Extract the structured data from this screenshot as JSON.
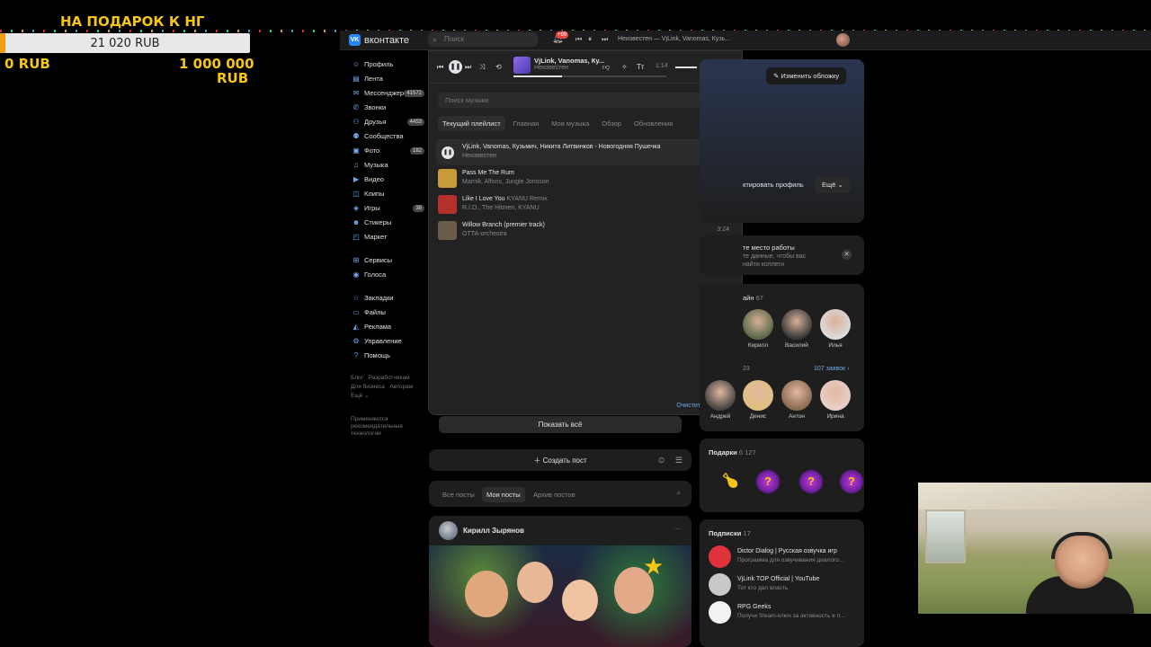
{
  "overlay": {
    "title": "НА ПОДАРОК К НГ",
    "current": "21 020 RUB",
    "min": "0 RUB",
    "max_line1": "1 000 000",
    "max_line2": "RUB",
    "progress_fraction": 0.021
  },
  "topbar": {
    "brand": "вконтакте",
    "search_placeholder": "Поиск",
    "notif_badge": "+99",
    "now_playing": "Неизвестен — VjLink, Vanomas, Кузь..."
  },
  "nav": {
    "items": [
      {
        "label": "Профиль",
        "icon": "user-icon",
        "count": ""
      },
      {
        "label": "Лента",
        "icon": "feed-icon",
        "count": ""
      },
      {
        "label": "Мессенджер",
        "icon": "chat-icon",
        "count": "41572"
      },
      {
        "label": "Звонки",
        "icon": "phone-icon",
        "count": ""
      },
      {
        "label": "Друзья",
        "icon": "friends-icon",
        "count": "4453"
      },
      {
        "label": "Сообщества",
        "icon": "groups-icon",
        "count": ""
      },
      {
        "label": "Фото",
        "icon": "photo-icon",
        "count": "182"
      },
      {
        "label": "Музыка",
        "icon": "music-icon",
        "count": ""
      },
      {
        "label": "Видео",
        "icon": "video-icon",
        "count": ""
      },
      {
        "label": "Клипы",
        "icon": "clips-icon",
        "count": ""
      },
      {
        "label": "Игры",
        "icon": "games-icon",
        "count": "38"
      },
      {
        "label": "Стикеры",
        "icon": "sticker-icon",
        "count": ""
      },
      {
        "label": "Маркет",
        "icon": "market-icon",
        "count": ""
      }
    ],
    "items2": [
      {
        "label": "Сервисы",
        "icon": "services-icon"
      },
      {
        "label": "Голоса",
        "icon": "votes-icon"
      }
    ],
    "items3": [
      {
        "label": "Закладки",
        "icon": "bookmark-icon"
      },
      {
        "label": "Файлы",
        "icon": "file-icon"
      },
      {
        "label": "Реклама",
        "icon": "ads-icon"
      },
      {
        "label": "Управление",
        "icon": "manage-icon"
      },
      {
        "label": "Помощь",
        "icon": "help-icon"
      }
    ],
    "footer": [
      "Блог",
      "Разработчикам",
      "Для бизнеса",
      "Авторам",
      "Ещё ⌄"
    ],
    "recommend": "Применяются рекомендательные технологии"
  },
  "music": {
    "current_title": "VjLink, Vanomas, Ку...",
    "current_artist": "Неизвестен",
    "time": "1:14",
    "progress_fraction": 0.32,
    "search_placeholder": "Поиск музыки",
    "tabs": [
      "Текущий плейлист",
      "Главная",
      "Моя музыка",
      "Обзор",
      "Обновления"
    ],
    "tracks": [
      {
        "title": "VjLink, Vanomas, Кузьмич, Никита Литвинков - Новогодняя Пушечка",
        "remix": "",
        "artist": "Неизвестен",
        "duration": "",
        "color": "#7a5ad8"
      },
      {
        "title": "Pass Me The Rum",
        "remix": "",
        "artist": "Marnik, Alfons, Jungle Jonsson",
        "duration": "2:33",
        "color": "#c79a3a"
      },
      {
        "title": "Like I Love You",
        "remix": "KYANU Remix",
        "artist": "R.I.O., The Hitmen, KYANU",
        "duration": "2:32",
        "color": "#b5302a"
      },
      {
        "title": "Willow Branch (premier track)",
        "remix": "",
        "artist": "OTTA-orchestra",
        "duration": "3:24",
        "color": "#6a5e4a"
      }
    ],
    "clear_label": "Очистить плейлист"
  },
  "feed": {
    "show_all": "Показать всё",
    "create_post": "Создать пост",
    "post_tabs": [
      "Все посты",
      "Мои посты",
      "Архив постов"
    ],
    "author": "Кирилл Зырянов"
  },
  "right": {
    "change_cover": "Изменить обложку",
    "edit_profile": "ктировать профиль",
    "more": "Ещё",
    "work_title": "те место работы",
    "work_desc": "те данные, чтобы вас найти коллеги",
    "friends_header": "айн",
    "friends_count": "67",
    "friends_online": [
      {
        "name": "Кирилл",
        "color": "#5a6a4a"
      },
      {
        "name": "Василий",
        "color": "#3a3a3a"
      },
      {
        "name": "Илья",
        "color": "#dcdcdc"
      }
    ],
    "friends_label2": "23",
    "requests_label": "107 заявок",
    "friends_all": [
      {
        "name": "Андрей",
        "color": "#444"
      },
      {
        "name": "Денис",
        "color": "#e0c080"
      },
      {
        "name": "Антон",
        "color": "#8a6a50"
      },
      {
        "name": "Ирина",
        "color": "#e8d0c8"
      }
    ],
    "gifts_title": "Подарки",
    "gifts_count": "6 127",
    "subs_title": "Подписки",
    "subs_count": "17",
    "subs": [
      {
        "name": "Dictor Dialog | Русская озвучка игр",
        "desc": "Программа для озвучивания диалого...",
        "color": "#e0323c"
      },
      {
        "name": "VjLink TOP Official | YouTube",
        "desc": "Тот кто дал власть",
        "color": "#c8c8c8"
      },
      {
        "name": "RPG Geeks",
        "desc": "Получи Steam-ключ за активность в п...",
        "color": "#f2f2f2"
      }
    ]
  }
}
